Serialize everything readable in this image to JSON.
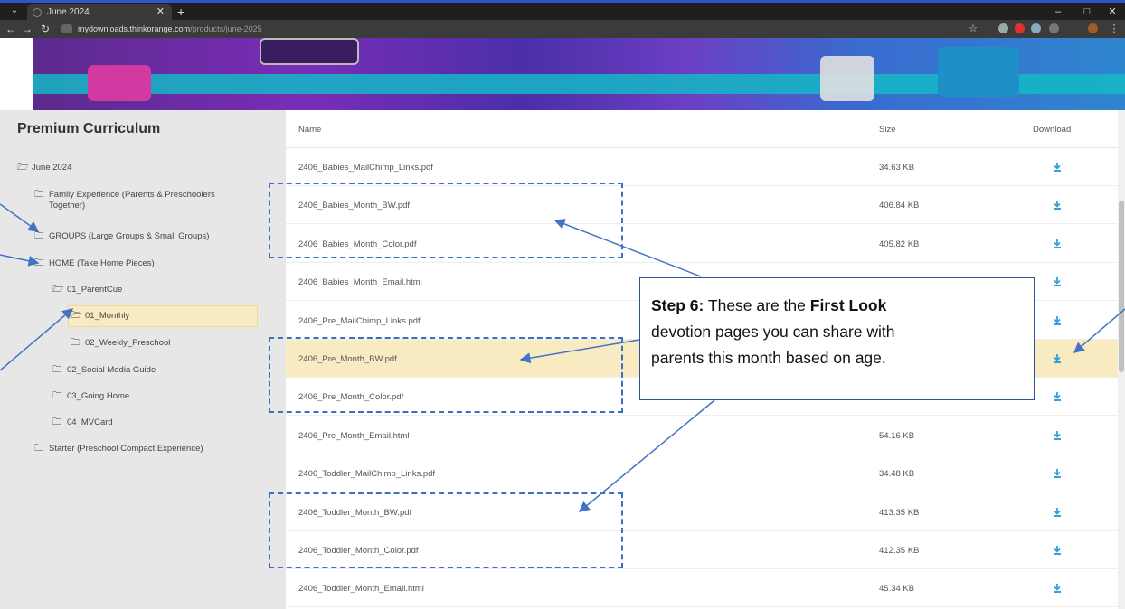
{
  "browser": {
    "tab_title": "June 2024",
    "url_domain": "mydownloads.thinkorange.com",
    "url_path": "/products/june-2025",
    "window_controls": [
      "–",
      "□",
      "✕"
    ]
  },
  "sidebar": {
    "title": "Premium Curriculum",
    "items": [
      {
        "label": "June 2024",
        "icon": "folder-open-icon"
      },
      {
        "label": "Family Experience (Parents & Preschoolers",
        "label2": "Together)",
        "icon": "folder-icon"
      },
      {
        "label": "GROUPS (Large Groups & Small Groups)",
        "icon": "folder-icon"
      },
      {
        "label": "HOME (Take Home Pieces)",
        "icon": "folder-icon"
      },
      {
        "label": "01_ParentCue",
        "icon": "folder-open-icon"
      },
      {
        "label": "01_Monthly",
        "icon": "folder-open-icon"
      },
      {
        "label": "02_Weekly_Preschool",
        "icon": "folder-icon"
      },
      {
        "label": "02_Social Media Guide",
        "icon": "folder-icon"
      },
      {
        "label": "03_Going Home",
        "icon": "folder-icon"
      },
      {
        "label": "04_MVCard",
        "icon": "folder-icon"
      },
      {
        "label": "Starter (Preschool Compact Experience)",
        "icon": "folder-icon"
      }
    ]
  },
  "table": {
    "headers": {
      "name": "Name",
      "size": "Size",
      "download": "Download"
    },
    "rows": [
      {
        "name": "2406_Babies_MailChimp_Links.pdf",
        "size": "34.63 KB"
      },
      {
        "name": "2406_Babies_Month_BW.pdf",
        "size": "406.84 KB"
      },
      {
        "name": "2406_Babies_Month_Color.pdf",
        "size": "405.82 KB"
      },
      {
        "name": "2406_Babies_Month_Email.html",
        "size": ""
      },
      {
        "name": "2406_Pre_MailChimp_Links.pdf",
        "size": ""
      },
      {
        "name": "2406_Pre_Month_BW.pdf",
        "size": ""
      },
      {
        "name": "2406_Pre_Month_Color.pdf",
        "size": ""
      },
      {
        "name": "2406_Pre_Month_Email.html",
        "size": "54.16 KB"
      },
      {
        "name": "2406_Toddler_MailChimp_Links.pdf",
        "size": "34.48 KB"
      },
      {
        "name": "2406_Toddler_Month_BW.pdf",
        "size": "413.35 KB"
      },
      {
        "name": "2406_Toddler_Month_Color.pdf",
        "size": "412.35 KB"
      },
      {
        "name": "2406_Toddler_Month_Email.html",
        "size": "45.34 KB"
      }
    ],
    "selected_row": 5,
    "download_icon": "download-icon"
  },
  "callout": {
    "step_label": "Step 6:",
    "text_a": " These are the ",
    "emphasis": "First Look",
    "text_b": "devotion pages you can share with",
    "text_c": "parents this month based on age."
  },
  "colors": {
    "highlight": "#f8ebc1",
    "annotation_blue": "#3a6fc4",
    "download_blue": "#3aa0d8"
  }
}
